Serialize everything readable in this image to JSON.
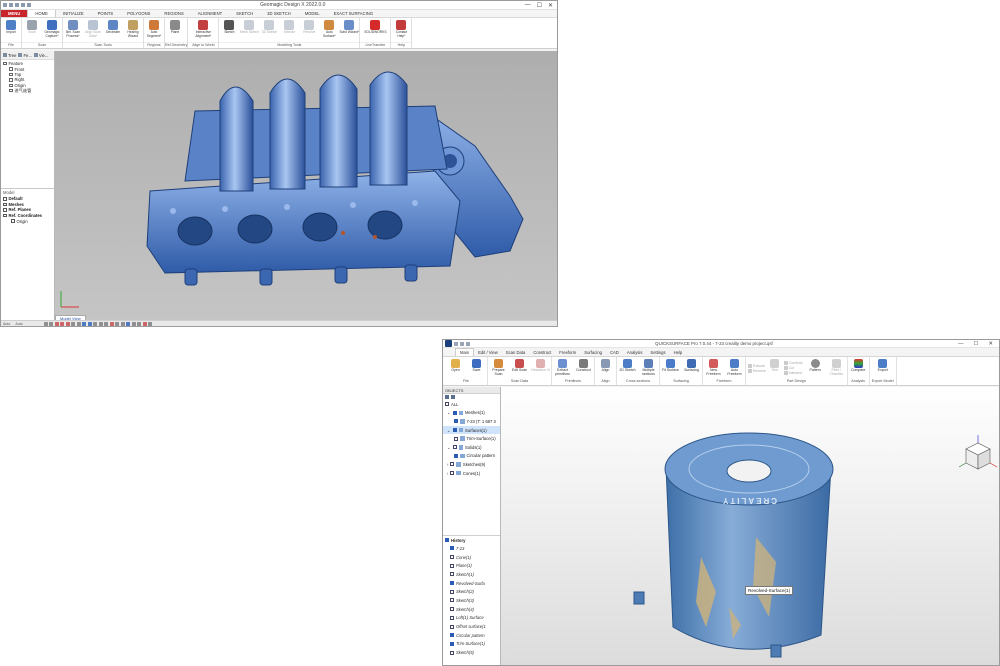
{
  "window1": {
    "title": "Geomagic Design X 2022.0.0",
    "window_controls": [
      "—",
      "☐",
      "✕"
    ],
    "menu_tabs": [
      "MENU",
      "HOME",
      "INITIALIZE",
      "POINTS",
      "POLYGONS",
      "REGIONS",
      "ALIGNMENT",
      "SKETCH",
      "3D SKETCH",
      "MODEL",
      "EXACT SURFACING"
    ],
    "active_tab": "HOME",
    "ribbon_groups": [
      {
        "label": "File",
        "buttons": [
          "Import"
        ]
      },
      {
        "label": "Scan",
        "buttons": [
          "Scan",
          "Geomagic Capture*"
        ]
      },
      {
        "label": "Scan Tools",
        "buttons": [
          "Bel. Scan Process*",
          "Align Scan Data*",
          "Decimate",
          "Healing Wizard"
        ]
      },
      {
        "label": "Regions",
        "buttons": [
          "Auto Segment*"
        ]
      },
      {
        "label": "Ref.Geometry",
        "buttons": [
          "Plane"
        ]
      },
      {
        "label": "Align to World",
        "buttons": [
          "Interactive Alignment*"
        ]
      },
      {
        "label": "Modeling Tools",
        "buttons": [
          "Sketch",
          "Mesh Sketch",
          "3D Sketch",
          "Extrude",
          "Revolve",
          "Auto Surface*",
          "Solid Wizard*"
        ]
      },
      {
        "label": "LiveTransfer",
        "buttons": [
          "SOLIDWORKS"
        ]
      },
      {
        "label": "Help",
        "buttons": [
          "Contact Help*"
        ]
      }
    ],
    "panel_tabs": [
      "Tree",
      "Fe...",
      "Vie..."
    ],
    "feature_tree": [
      "Feature",
      "Front",
      "Top",
      "Right",
      "Origin",
      "进气歧管"
    ],
    "model_tree": {
      "header": "Model",
      "items": [
        "Default",
        "Meshes",
        "Ref. Planes",
        "Ref. Coordinates",
        "Origin"
      ]
    },
    "view_tab": "Model View",
    "status": [
      "Auto",
      "Auto"
    ]
  },
  "window2": {
    "title": "QUICKSURFACE Pro 7.0.44 - 7-23 creality demo project.qsf",
    "window_controls": [
      "—",
      "☐",
      "✕"
    ],
    "menu_tabs": [
      "Main",
      "Edit / View",
      "Scan Data",
      "Construct",
      "Freeform",
      "Surfacing",
      "CAD",
      "Analysis",
      "Settings",
      "Help"
    ],
    "active_tab": "Main",
    "ribbon_groups": [
      {
        "label": "File",
        "buttons": [
          "Open",
          "Save"
        ]
      },
      {
        "label": "Scan Data",
        "buttons": [
          "Prepare Scan",
          "Edit Scan",
          "Deviation Vi"
        ]
      },
      {
        "label": "Primitives",
        "buttons": [
          "Extract primitives",
          "Construct"
        ]
      },
      {
        "label": "Align",
        "buttons": [
          "Align"
        ]
      },
      {
        "label": "Cross sections",
        "buttons": [
          "2D Sketch",
          "Multiple sections"
        ]
      },
      {
        "label": "Surfacing",
        "buttons": [
          "Fit Surface",
          "Surfacing"
        ]
      },
      {
        "label": "Freeform",
        "buttons": [
          "New Freeform",
          "Auto Freeform"
        ]
      },
      {
        "label": "Part Design",
        "buttons": [
          "Extrude",
          "Revolve",
          "Trim",
          "Combine",
          "Cut",
          "Intersect",
          "Pattern",
          "Fillet / Chamfer"
        ]
      },
      {
        "label": "Analysis",
        "buttons": [
          "Compare"
        ]
      },
      {
        "label": "Export Model",
        "buttons": [
          "Export"
        ]
      }
    ],
    "objects_header": "OBJECTS",
    "objects_tree": [
      {
        "label": "ALL",
        "level": 0
      },
      {
        "label": "Meshes(1)",
        "level": 0
      },
      {
        "label": "7-23 (T: 1 687 3",
        "level": 1
      },
      {
        "label": "Surfaces(1)",
        "level": 0
      },
      {
        "label": "Trim-Surface(1)",
        "level": 1
      },
      {
        "label": "Solids(1)",
        "level": 0
      },
      {
        "label": "Circular pattern",
        "level": 1
      },
      {
        "label": "Sketches(9)",
        "level": 0
      },
      {
        "label": "Cones(1)",
        "level": 0
      }
    ],
    "history_header": "History",
    "history": [
      "7-23",
      "Cone(1)",
      "Plane(1)",
      "Sketch(1)",
      "Revolved-Surfa",
      "Sketch(2)",
      "Sketch(3)",
      "Sketch(4)",
      "Loft(1) Surface",
      "Offset surface(1",
      "Circular pattern",
      "Trim-Surface(1)",
      "Sketch(5)"
    ],
    "tooltip": "Revolved-Surface(1)",
    "cap_lettering": "CREALITY"
  }
}
